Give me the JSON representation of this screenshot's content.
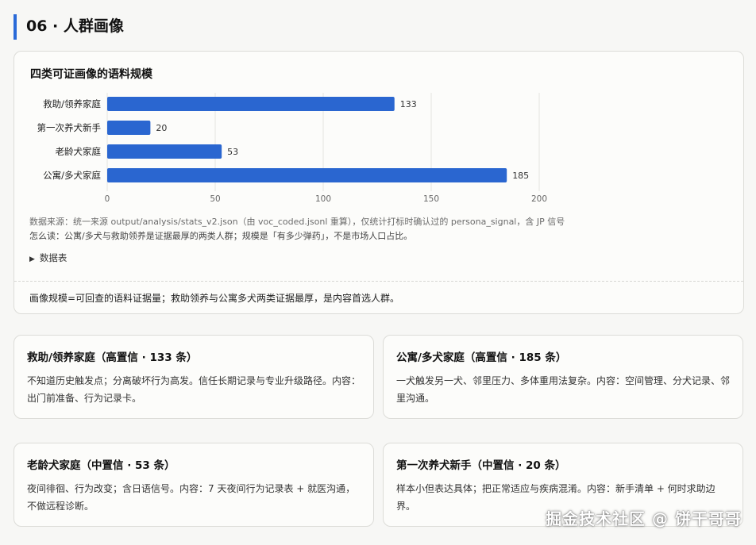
{
  "section": {
    "title": "06 · 人群画像"
  },
  "chart_card": {
    "title": "四类可证画像的语料规模",
    "source_note": "数据来源：统一来源 output/analysis/stats_v2.json（由 voc_coded.jsonl 重算），仅统计打标时确认过的 persona_signal，含 JP 信号",
    "howto_note": "怎么读：公寓/多犬与救助领养是证据最厚的两类人群；规模是「有多少弹药」，不是市场人口占比。",
    "data_table_toggle": "数据表",
    "summary": "画像规模=可回查的语料证据量；救助领养与公寓多犬两类证据最厚，是内容首选人群。"
  },
  "chart_data": {
    "type": "bar",
    "orientation": "horizontal",
    "title": "四类可证画像的语料规模",
    "categories": [
      "救助/领养家庭",
      "第一次养犬新手",
      "老龄犬家庭",
      "公寓/多犬家庭"
    ],
    "values": [
      133,
      20,
      53,
      185
    ],
    "xlim": [
      0,
      200
    ],
    "xticks": [
      0,
      50,
      100,
      150,
      200
    ],
    "grid": "vertical",
    "bar_color": "#2a66d0",
    "data_labels": true
  },
  "personas": [
    {
      "title": "救助/领养家庭（高置信 · 133 条）",
      "body": "不知道历史触发点；分离破坏行为高发。信任长期记录与专业升级路径。内容：出门前准备、行为记录卡。"
    },
    {
      "title": "公寓/多犬家庭（高置信 · 185 条）",
      "body": "一犬触发另一犬、邻里压力、多体重用法复杂。内容：空间管理、分犬记录、邻里沟通。"
    },
    {
      "title": "老龄犬家庭（中置信 · 53 条）",
      "body": "夜间徘徊、行为改变；含日语信号。内容：7 天夜间行为记录表 + 就医沟通，不做远程诊断。"
    },
    {
      "title": "第一次养犬新手（中置信 · 20 条）",
      "body": "样本小但表达具体；把正常适应与疾病混淆。内容：新手清单 + 何时求助边界。"
    }
  ],
  "watermark": "掘金技术社区 @ 饼干哥哥"
}
